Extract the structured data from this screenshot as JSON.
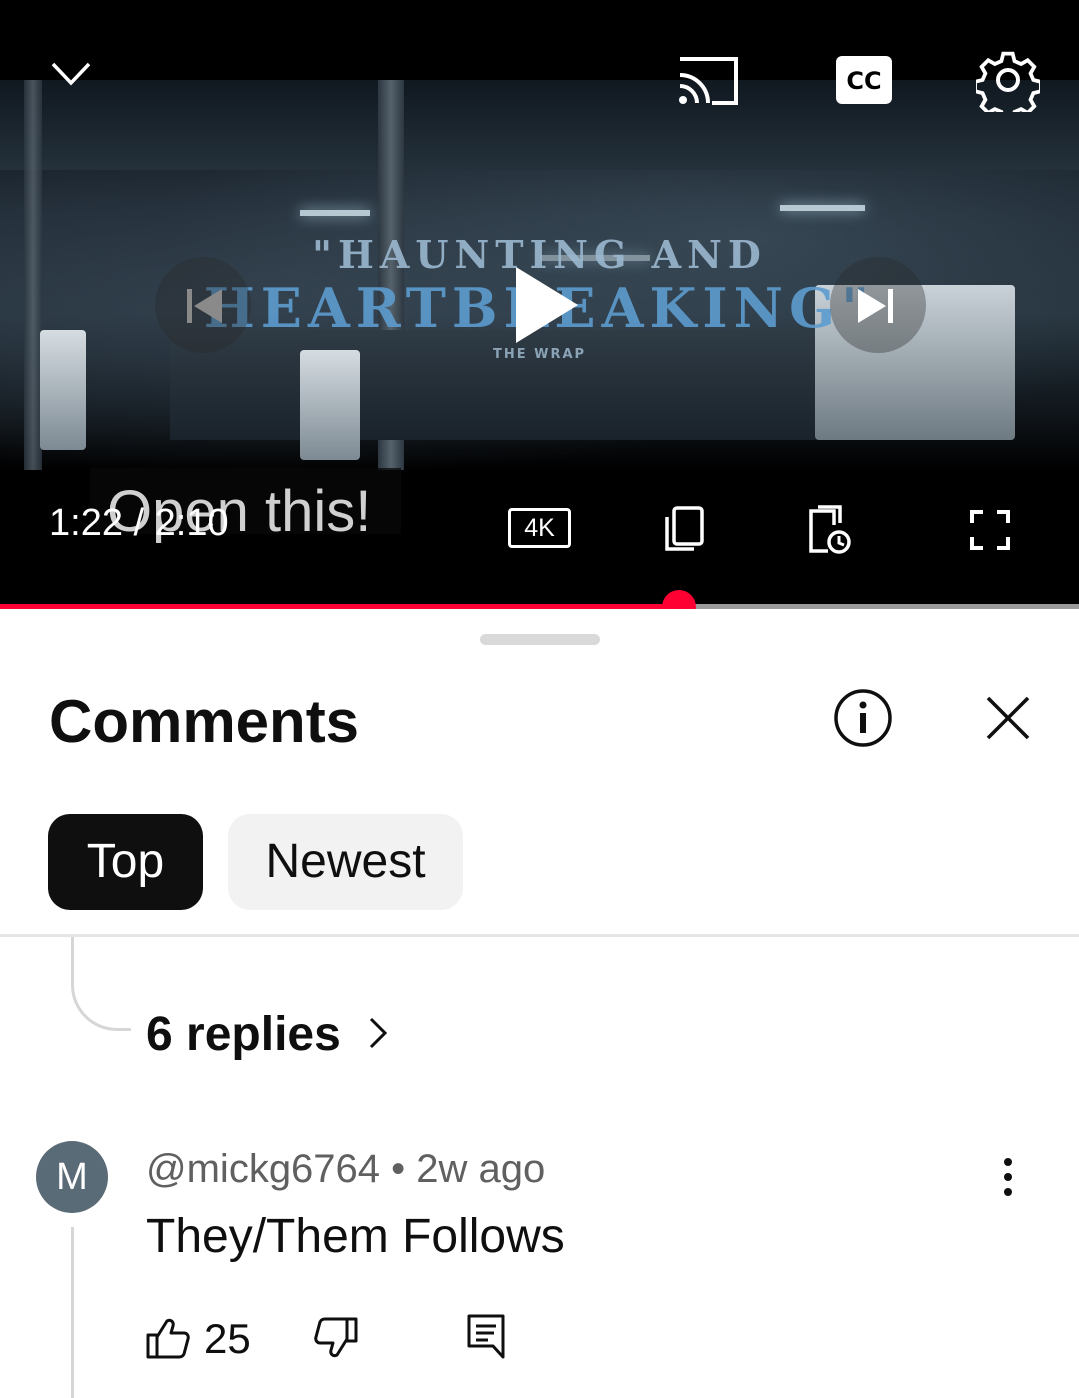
{
  "player": {
    "overlay_line1": "\"HAUNTING AND",
    "overlay_line2": "HEARTBREAKING\"",
    "overlay_source": "THE WRAP",
    "caption": "Open this!",
    "time": "1:22 / 2:10",
    "quality_badge": "4K",
    "progress": 0.629
  },
  "comments": {
    "title": "Comments",
    "filters": [
      "Top",
      "Newest"
    ],
    "selected_filter": "Top",
    "replies_label": "6 replies",
    "comment": {
      "avatar_letter": "M",
      "author": "@mickg6764",
      "separator": " • ",
      "age": "2w ago",
      "text": "They/Them Follows",
      "likes": "25"
    }
  },
  "colors": {
    "accent": "#ff0033",
    "chip_selected_bg": "#0f0f0f",
    "chip_bg": "#f2f2f2",
    "avatar_bg": "#5a6b78"
  },
  "icons": [
    "chevron-down-icon",
    "cast-icon",
    "closed-captions-icon",
    "settings-gear-icon",
    "previous-icon",
    "play-icon",
    "next-icon",
    "copy-icon",
    "queue-watch-later-icon",
    "fullscreen-icon",
    "info-icon",
    "close-icon",
    "chevron-right-icon",
    "more-vertical-icon",
    "thumbs-up-icon",
    "thumbs-down-icon",
    "reply-icon"
  ]
}
